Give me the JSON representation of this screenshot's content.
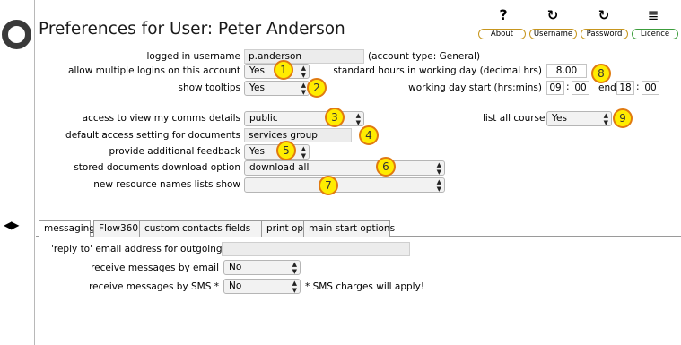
{
  "header": {
    "title": "Preferences for User: Peter Anderson",
    "buttons": [
      {
        "label": "About",
        "icon": "question-icon"
      },
      {
        "label": "Username",
        "icon": "refresh-icon"
      },
      {
        "label": "Password",
        "icon": "refresh-icon"
      },
      {
        "label": "Licence",
        "icon": "document-icon"
      }
    ]
  },
  "icons": {
    "about": "?",
    "refresh": "↻",
    "document": "≣",
    "nav": "◀▶"
  },
  "prefs": {
    "logged_in_label": "logged in username",
    "logged_in_value": "p.anderson",
    "account_type": "(account type: General)",
    "multiple_logins_label": "allow multiple logins on this account",
    "multiple_logins_value": "Yes",
    "show_tooltips_label": "show tooltips",
    "show_tooltips_value": "Yes",
    "std_hours_label": "standard hours in working day (decimal hrs)",
    "std_hours_value": "8.00",
    "day_start_label": "working day start (hrs:mins)",
    "start_h": "09",
    "start_m": "00",
    "end_label": "end",
    "end_h": "18",
    "end_m": "00",
    "time_sep": ":",
    "comms_label": "access to view my comms details",
    "comms_value": "public",
    "doc_access_label": "default access setting for documents",
    "doc_access_value": "services group",
    "feedback_label": "provide additional feedback",
    "feedback_value": "Yes",
    "download_label": "stored documents download option",
    "download_value": "download all",
    "resource_label": "new resource names lists show",
    "resource_value": "",
    "courses_label": "list all courses",
    "courses_value": "Yes"
  },
  "callouts": [
    "1",
    "2",
    "3",
    "4",
    "5",
    "6",
    "7",
    "8",
    "9"
  ],
  "tabs": [
    "messaging",
    "Flow360",
    "custom contacts fields",
    "print options",
    "main start options"
  ],
  "messaging": {
    "reply_to_label": "'reply to' email address for outgoing mail",
    "reply_to_value": "",
    "email_label": "receive messages by email",
    "email_value": "No",
    "sms_label": "receive messages by SMS *",
    "sms_value": "No",
    "sms_note": "* SMS charges will apply!"
  },
  "colors": {
    "callout_fill": "#ffec00",
    "callout_border": "#e07a10",
    "toolbar_border": "#c7961e",
    "licence_border": "#3c9d3c"
  }
}
